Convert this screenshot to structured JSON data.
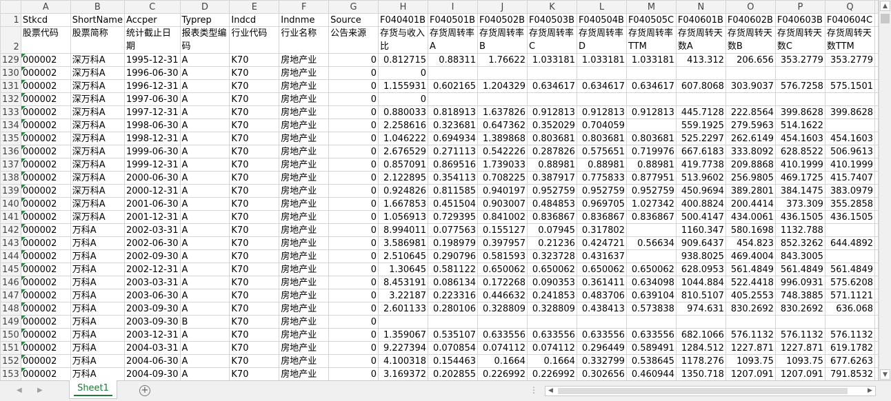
{
  "columns": [
    "A",
    "B",
    "C",
    "D",
    "E",
    "F",
    "G",
    "H",
    "I",
    "J",
    "K",
    "L",
    "M",
    "N",
    "O",
    "P",
    "Q"
  ],
  "header_row1": {
    "num": "1",
    "cells": [
      "Stkcd",
      "ShortName",
      "Accper",
      "Typrep",
      "Indcd",
      "Indnme",
      "Source",
      "F040401B",
      "F040501B",
      "F040502B",
      "F040503B",
      "F040504B",
      "F040505C",
      "F040601B",
      "F040602B",
      "F040603B",
      "F040604C"
    ]
  },
  "header_row2": {
    "num": "2",
    "cells": [
      "股票代码",
      "股票简称",
      "统计截止日期",
      "报表类型编码",
      "行业代码",
      "行业名称",
      "公告来源",
      "存货与收入比",
      "存货周转率A",
      "存货周转率B",
      "存货周转率C",
      "存货周转率D",
      "存货周转率TTM",
      "存货周转天数A",
      "存货周转天数B",
      "存货周转天数C",
      "存货周转天数TTM"
    ]
  },
  "rows": [
    {
      "num": "129",
      "cells": [
        "000002",
        "深万科A",
        "1995-12-31",
        "A",
        "K70",
        "房地产业",
        "0",
        "0.812715",
        "0.88311",
        "1.76622",
        "1.033181",
        "1.033181",
        "1.033181",
        "413.312",
        "206.656",
        "353.2779",
        "353.2779"
      ]
    },
    {
      "num": "130",
      "cells": [
        "000002",
        "深万科A",
        "1996-06-30",
        "A",
        "K70",
        "房地产业",
        "0",
        "0",
        "",
        "",
        "",
        "",
        "",
        "",
        "",
        "",
        ""
      ]
    },
    {
      "num": "131",
      "cells": [
        "000002",
        "深万科A",
        "1996-12-31",
        "A",
        "K70",
        "房地产业",
        "0",
        "1.155931",
        "0.602165",
        "1.204329",
        "0.634617",
        "0.634617",
        "0.634617",
        "607.8068",
        "303.9037",
        "576.7258",
        "575.1501"
      ]
    },
    {
      "num": "132",
      "cells": [
        "000002",
        "深万科A",
        "1997-06-30",
        "A",
        "K70",
        "房地产业",
        "0",
        "0",
        "",
        "",
        "",
        "",
        "",
        "",
        "",
        "",
        ""
      ]
    },
    {
      "num": "133",
      "cells": [
        "000002",
        "深万科A",
        "1997-12-31",
        "A",
        "K70",
        "房地产业",
        "0",
        "0.880033",
        "0.818913",
        "1.637826",
        "0.912813",
        "0.912813",
        "0.912813",
        "445.7128",
        "222.8564",
        "399.8628",
        "399.8628"
      ]
    },
    {
      "num": "134",
      "cells": [
        "000002",
        "深万科A",
        "1998-06-30",
        "A",
        "K70",
        "房地产业",
        "0",
        "2.258616",
        "0.323681",
        "0.647362",
        "0.352029",
        "0.704059",
        "",
        "559.1925",
        "279.5963",
        "514.1622",
        ""
      ]
    },
    {
      "num": "135",
      "cells": [
        "000002",
        "深万科A",
        "1998-12-31",
        "A",
        "K70",
        "房地产业",
        "0",
        "1.046222",
        "0.694934",
        "1.389868",
        "0.803681",
        "0.803681",
        "0.803681",
        "525.2297",
        "262.6149",
        "454.1603",
        "454.1603"
      ]
    },
    {
      "num": "136",
      "cells": [
        "000002",
        "深万科A",
        "1999-06-30",
        "A",
        "K70",
        "房地产业",
        "0",
        "2.676529",
        "0.271113",
        "0.542226",
        "0.287826",
        "0.575651",
        "0.719976",
        "667.6183",
        "333.8092",
        "628.8522",
        "506.9613"
      ]
    },
    {
      "num": "137",
      "cells": [
        "000002",
        "深万科A",
        "1999-12-31",
        "A",
        "K70",
        "房地产业",
        "0",
        "0.857091",
        "0.869516",
        "1.739033",
        "0.88981",
        "0.88981",
        "0.88981",
        "419.7738",
        "209.8868",
        "410.1999",
        "410.1999"
      ]
    },
    {
      "num": "138",
      "cells": [
        "000002",
        "深万科A",
        "2000-06-30",
        "A",
        "K70",
        "房地产业",
        "0",
        "2.122895",
        "0.354113",
        "0.708225",
        "0.387917",
        "0.775833",
        "0.877951",
        "513.9602",
        "256.9805",
        "469.1725",
        "415.7407"
      ]
    },
    {
      "num": "139",
      "cells": [
        "000002",
        "深万科A",
        "2000-12-31",
        "A",
        "K70",
        "房地产业",
        "0",
        "0.924826",
        "0.811585",
        "0.940197",
        "0.952759",
        "0.952759",
        "0.952759",
        "450.9694",
        "389.2801",
        "384.1475",
        "383.0979"
      ]
    },
    {
      "num": "140",
      "cells": [
        "000002",
        "深万科A",
        "2001-06-30",
        "A",
        "K70",
        "房地产业",
        "0",
        "1.667853",
        "0.451504",
        "0.903007",
        "0.484853",
        "0.969705",
        "1.027342",
        "400.8824",
        "200.4414",
        "373.309",
        "355.2858"
      ]
    },
    {
      "num": "141",
      "cells": [
        "000002",
        "深万科A",
        "2001-12-31",
        "A",
        "K70",
        "房地产业",
        "0",
        "1.056913",
        "0.729395",
        "0.841002",
        "0.836867",
        "0.836867",
        "0.836867",
        "500.4147",
        "434.0061",
        "436.1505",
        "436.1505"
      ]
    },
    {
      "num": "142",
      "cells": [
        "000002",
        "万科A",
        "2002-03-31",
        "A",
        "K70",
        "房地产业",
        "0",
        "8.994011",
        "0.077563",
        "0.155127",
        "0.07945",
        "0.317802",
        "",
        "1160.347",
        "580.1698",
        "1132.788",
        ""
      ]
    },
    {
      "num": "143",
      "cells": [
        "000002",
        "万科A",
        "2002-06-30",
        "A",
        "K70",
        "房地产业",
        "0",
        "3.586981",
        "0.198979",
        "0.397957",
        "0.21236",
        "0.424721",
        "0.56634",
        "909.6437",
        "454.823",
        "852.3262",
        "644.4892"
      ]
    },
    {
      "num": "144",
      "cells": [
        "000002",
        "万科A",
        "2002-09-30",
        "A",
        "K70",
        "房地产业",
        "0",
        "2.510645",
        "0.290796",
        "0.581593",
        "0.323728",
        "0.431637",
        "",
        "938.8025",
        "469.4004",
        "843.3005",
        ""
      ]
    },
    {
      "num": "145",
      "cells": [
        "000002",
        "万科A",
        "2002-12-31",
        "A",
        "K70",
        "房地产业",
        "0",
        "1.30645",
        "0.581122",
        "0.650062",
        "0.650062",
        "0.650062",
        "0.650062",
        "628.0953",
        "561.4849",
        "561.4849",
        "561.4849"
      ]
    },
    {
      "num": "146",
      "cells": [
        "000002",
        "万科A",
        "2003-03-31",
        "A",
        "K70",
        "房地产业",
        "0",
        "8.453191",
        "0.086134",
        "0.172268",
        "0.090353",
        "0.361411",
        "0.634098",
        "1044.884",
        "522.4418",
        "996.0931",
        "575.6208"
      ]
    },
    {
      "num": "147",
      "cells": [
        "000002",
        "万科A",
        "2003-06-30",
        "A",
        "K70",
        "房地产业",
        "0",
        "3.22187",
        "0.223316",
        "0.446632",
        "0.241853",
        "0.483706",
        "0.639104",
        "810.5107",
        "405.2553",
        "748.3885",
        "571.1121"
      ]
    },
    {
      "num": "148",
      "cells": [
        "000002",
        "万科A",
        "2003-09-30",
        "A",
        "K70",
        "房地产业",
        "0",
        "2.601133",
        "0.280106",
        "0.328809",
        "0.328809",
        "0.438413",
        "0.573838",
        "974.631",
        "830.2692",
        "830.2692",
        "636.068"
      ]
    },
    {
      "num": "149",
      "cells": [
        "000002",
        "万科A",
        "2003-09-30",
        "B",
        "K70",
        "房地产业",
        "0",
        "",
        "",
        "",
        "",
        "",
        "",
        "",
        "",
        "",
        ""
      ]
    },
    {
      "num": "150",
      "cells": [
        "000002",
        "万科A",
        "2003-12-31",
        "A",
        "K70",
        "房地产业",
        "0",
        "1.359067",
        "0.535107",
        "0.633556",
        "0.633556",
        "0.633556",
        "0.633556",
        "682.1066",
        "576.1132",
        "576.1132",
        "576.1132"
      ]
    },
    {
      "num": "151",
      "cells": [
        "000002",
        "万科A",
        "2004-03-31",
        "A",
        "K70",
        "房地产业",
        "0",
        "9.227394",
        "0.070854",
        "0.074112",
        "0.074112",
        "0.296449",
        "0.589491",
        "1284.512",
        "1227.871",
        "1227.871",
        "619.1782"
      ]
    },
    {
      "num": "152",
      "cells": [
        "000002",
        "万科A",
        "2004-06-30",
        "A",
        "K70",
        "房地产业",
        "0",
        "4.100318",
        "0.154463",
        "0.1664",
        "0.1664",
        "0.332799",
        "0.538645",
        "1178.276",
        "1093.75",
        "1093.75",
        "677.6263"
      ]
    },
    {
      "num": "153",
      "cells": [
        "000002",
        "万科A",
        "2004-09-30",
        "A",
        "K70",
        "房地产业",
        "0",
        "3.169372",
        "0.202855",
        "0.226992",
        "0.226992",
        "0.302656",
        "0.460944",
        "1350.718",
        "1207.091",
        "1207.091",
        "791.8532"
      ]
    }
  ],
  "sheet_tab": "Sheet1",
  "add_sheet_label": "+"
}
